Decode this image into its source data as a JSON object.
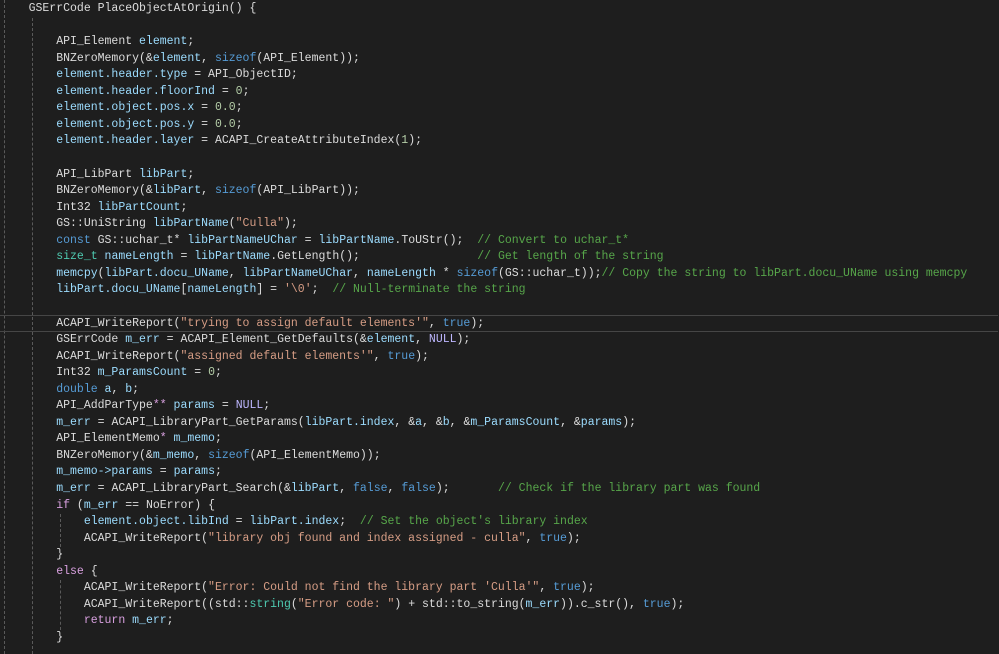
{
  "theme": {
    "background": "#1e1e1e",
    "p": "#dcdcdc",
    "k": "#569cd6",
    "v": "#9cdcfe",
    "s": "#d69d85",
    "c": "#57a64a",
    "n": "#b5cea8",
    "m": "#beb7ff",
    "f": "#d8a0df",
    "t": "#4ec9b0"
  },
  "current_line": 19,
  "lines": [
    [
      [
        "p",
        "    GSErrCode PlaceObjectAtOrigin() {"
      ]
    ],
    [],
    [
      [
        "p",
        "        API_Element "
      ],
      [
        "v",
        "element"
      ],
      [
        "p",
        ";"
      ]
    ],
    [
      [
        "p",
        "        BNZeroMemory(&"
      ],
      [
        "v",
        "element"
      ],
      [
        "p",
        ", "
      ],
      [
        "k",
        "sizeof"
      ],
      [
        "p",
        "(API_Element));"
      ]
    ],
    [
      [
        "p",
        "        "
      ],
      [
        "v",
        "element.header.type"
      ],
      [
        "p",
        " = API_ObjectID;"
      ]
    ],
    [
      [
        "p",
        "        "
      ],
      [
        "v",
        "element.header.floorInd"
      ],
      [
        "p",
        " = "
      ],
      [
        "n",
        "0"
      ],
      [
        "p",
        ";"
      ]
    ],
    [
      [
        "p",
        "        "
      ],
      [
        "v",
        "element.object.pos.x"
      ],
      [
        "p",
        " = "
      ],
      [
        "n",
        "0.0"
      ],
      [
        "p",
        ";"
      ]
    ],
    [
      [
        "p",
        "        "
      ],
      [
        "v",
        "element.object.pos.y"
      ],
      [
        "p",
        " = "
      ],
      [
        "n",
        "0.0"
      ],
      [
        "p",
        ";"
      ]
    ],
    [
      [
        "p",
        "        "
      ],
      [
        "v",
        "element.header.layer"
      ],
      [
        "p",
        " = ACAPI_CreateAttributeIndex("
      ],
      [
        "n",
        "1"
      ],
      [
        "p",
        ");"
      ]
    ],
    [],
    [
      [
        "p",
        "        API_LibPart "
      ],
      [
        "v",
        "libPart"
      ],
      [
        "p",
        ";"
      ]
    ],
    [
      [
        "p",
        "        BNZeroMemory(&"
      ],
      [
        "v",
        "libPart"
      ],
      [
        "p",
        ", "
      ],
      [
        "k",
        "sizeof"
      ],
      [
        "p",
        "(API_LibPart));"
      ]
    ],
    [
      [
        "p",
        "        Int32 "
      ],
      [
        "v",
        "libPartCount"
      ],
      [
        "p",
        ";"
      ]
    ],
    [
      [
        "p",
        "        GS::UniString "
      ],
      [
        "v",
        "libPartName"
      ],
      [
        "p",
        "("
      ],
      [
        "s",
        "\"Culla\""
      ],
      [
        "p",
        ");"
      ]
    ],
    [
      [
        "p",
        "        "
      ],
      [
        "k",
        "const"
      ],
      [
        "p",
        " GS::uchar_t* "
      ],
      [
        "v",
        "libPartNameUChar"
      ],
      [
        "p",
        " = "
      ],
      [
        "v",
        "libPartName"
      ],
      [
        "p",
        ".ToUStr();  "
      ],
      [
        "c",
        "// Convert to uchar_t*"
      ]
    ],
    [
      [
        "p",
        "        "
      ],
      [
        "t",
        "size_t"
      ],
      [
        "p",
        " "
      ],
      [
        "v",
        "nameLength"
      ],
      [
        "p",
        " = "
      ],
      [
        "v",
        "libPartName"
      ],
      [
        "p",
        ".GetLength();                 "
      ],
      [
        "c",
        "// Get length of the string"
      ]
    ],
    [
      [
        "p",
        "        "
      ],
      [
        "v",
        "memcpy"
      ],
      [
        "p",
        "("
      ],
      [
        "v",
        "libPart.docu_UName"
      ],
      [
        "p",
        ", "
      ],
      [
        "v",
        "libPartNameUChar"
      ],
      [
        "p",
        ", "
      ],
      [
        "v",
        "nameLength"
      ],
      [
        "p",
        " * "
      ],
      [
        "k",
        "sizeof"
      ],
      [
        "p",
        "(GS::uchar_t));"
      ],
      [
        "c",
        "// Copy the string to libPart.docu_UName using memcpy"
      ]
    ],
    [
      [
        "p",
        "        "
      ],
      [
        "v",
        "libPart.docu_UName"
      ],
      [
        "p",
        "["
      ],
      [
        "v",
        "nameLength"
      ],
      [
        "p",
        "] = "
      ],
      [
        "s",
        "'\\0'"
      ],
      [
        "p",
        ";  "
      ],
      [
        "c",
        "// Null-terminate the string"
      ]
    ],
    [],
    [
      [
        "p",
        "        ACAPI_WriteReport("
      ],
      [
        "s",
        "\"trying to assign default elements'\""
      ],
      [
        "p",
        ", "
      ],
      [
        "k",
        "true"
      ],
      [
        "p",
        ");"
      ]
    ],
    [
      [
        "p",
        "        GSErrCode "
      ],
      [
        "v",
        "m_err"
      ],
      [
        "p",
        " = ACAPI_Element_GetDefaults(&"
      ],
      [
        "v",
        "element"
      ],
      [
        "p",
        ", "
      ],
      [
        "m",
        "NULL"
      ],
      [
        "p",
        ");"
      ]
    ],
    [
      [
        "p",
        "        ACAPI_WriteReport("
      ],
      [
        "s",
        "\"assigned default elements'\""
      ],
      [
        "p",
        ", "
      ],
      [
        "k",
        "true"
      ],
      [
        "p",
        ");"
      ]
    ],
    [
      [
        "p",
        "        Int32 "
      ],
      [
        "v",
        "m_ParamsCount"
      ],
      [
        "p",
        " = "
      ],
      [
        "n",
        "0"
      ],
      [
        "p",
        ";"
      ]
    ],
    [
      [
        "p",
        "        "
      ],
      [
        "k",
        "double"
      ],
      [
        "p",
        " "
      ],
      [
        "v",
        "a"
      ],
      [
        "p",
        ", "
      ],
      [
        "v",
        "b"
      ],
      [
        "p",
        ";"
      ]
    ],
    [
      [
        "p",
        "        API_AddParType"
      ],
      [
        "f",
        "**"
      ],
      [
        "p",
        " "
      ],
      [
        "v",
        "params"
      ],
      [
        "p",
        " = "
      ],
      [
        "m",
        "NULL"
      ],
      [
        "p",
        ";"
      ]
    ],
    [
      [
        "p",
        "        "
      ],
      [
        "v",
        "m_err"
      ],
      [
        "p",
        " = ACAPI_LibraryPart_GetParams("
      ],
      [
        "v",
        "libPart.index"
      ],
      [
        "p",
        ", &"
      ],
      [
        "v",
        "a"
      ],
      [
        "p",
        ", &"
      ],
      [
        "v",
        "b"
      ],
      [
        "p",
        ", &"
      ],
      [
        "v",
        "m_ParamsCount"
      ],
      [
        "p",
        ", &"
      ],
      [
        "v",
        "params"
      ],
      [
        "p",
        ");"
      ]
    ],
    [
      [
        "p",
        "        API_ElementMemo"
      ],
      [
        "f",
        "*"
      ],
      [
        "p",
        " "
      ],
      [
        "v",
        "m_memo"
      ],
      [
        "p",
        ";"
      ]
    ],
    [
      [
        "p",
        "        BNZeroMemory(&"
      ],
      [
        "v",
        "m_memo"
      ],
      [
        "p",
        ", "
      ],
      [
        "k",
        "sizeof"
      ],
      [
        "p",
        "(API_ElementMemo));"
      ]
    ],
    [
      [
        "p",
        "        "
      ],
      [
        "v",
        "m_memo->params"
      ],
      [
        "p",
        " = "
      ],
      [
        "v",
        "params"
      ],
      [
        "p",
        ";"
      ]
    ],
    [
      [
        "p",
        "        "
      ],
      [
        "v",
        "m_err"
      ],
      [
        "p",
        " = ACAPI_LibraryPart_Search(&"
      ],
      [
        "v",
        "libPart"
      ],
      [
        "p",
        ", "
      ],
      [
        "k",
        "false"
      ],
      [
        "p",
        ", "
      ],
      [
        "k",
        "false"
      ],
      [
        "p",
        ");       "
      ],
      [
        "c",
        "// Check if the library part was found"
      ]
    ],
    [
      [
        "p",
        "        "
      ],
      [
        "f",
        "if"
      ],
      [
        "p",
        " ("
      ],
      [
        "v",
        "m_err"
      ],
      [
        "p",
        " == NoError) {"
      ]
    ],
    [
      [
        "p",
        "            "
      ],
      [
        "v",
        "element.object.libInd"
      ],
      [
        "p",
        " = "
      ],
      [
        "v",
        "libPart.index"
      ],
      [
        "p",
        ";  "
      ],
      [
        "c",
        "// Set the object's library index"
      ]
    ],
    [
      [
        "p",
        "            ACAPI_WriteReport("
      ],
      [
        "s",
        "\"library obj found and index assigned - culla\""
      ],
      [
        "p",
        ", "
      ],
      [
        "k",
        "true"
      ],
      [
        "p",
        ");"
      ]
    ],
    [
      [
        "p",
        "        }"
      ]
    ],
    [
      [
        "p",
        "        "
      ],
      [
        "f",
        "else"
      ],
      [
        "p",
        " {"
      ]
    ],
    [
      [
        "p",
        "            ACAPI_WriteReport("
      ],
      [
        "s",
        "\"Error: Could not find the library part 'Culla'\""
      ],
      [
        "p",
        ", "
      ],
      [
        "k",
        "true"
      ],
      [
        "p",
        ");"
      ]
    ],
    [
      [
        "p",
        "            ACAPI_WriteReport((std::"
      ],
      [
        "t",
        "string"
      ],
      [
        "p",
        "("
      ],
      [
        "s",
        "\"Error code: \""
      ],
      [
        "p",
        ") + std::to_string("
      ],
      [
        "v",
        "m_err"
      ],
      [
        "p",
        ")).c_str(), "
      ],
      [
        "k",
        "true"
      ],
      [
        "p",
        ");"
      ]
    ],
    [
      [
        "p",
        "            "
      ],
      [
        "f",
        "return"
      ],
      [
        "p",
        " "
      ],
      [
        "v",
        "m_err"
      ],
      [
        "p",
        ";"
      ]
    ],
    [
      [
        "p",
        "        }"
      ]
    ]
  ]
}
